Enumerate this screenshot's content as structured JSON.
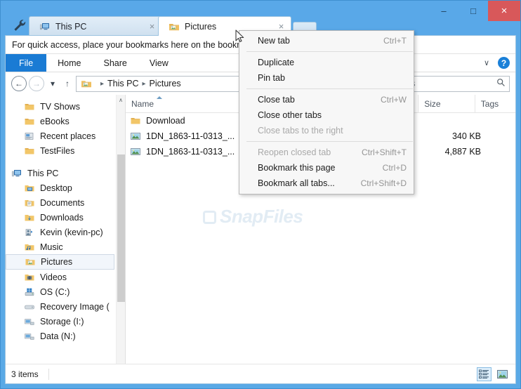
{
  "window": {
    "accent_color": "#59a8e8",
    "close_color": "#d8585a",
    "buttons": {
      "minimize": "–",
      "maximize": "□",
      "close": "×"
    }
  },
  "tabstrip": {
    "tabs": [
      {
        "label": "This PC",
        "icon": "computer-icon",
        "close": "×",
        "active": false
      },
      {
        "label": "Pictures",
        "icon": "pictures-folder-icon",
        "close": "×",
        "active": true
      }
    ],
    "new_tab_button": ""
  },
  "bookmark_bar": {
    "hint": "For quick access, place your bookmarks here on the bookma"
  },
  "ribbon": {
    "tabs": [
      {
        "label": "File",
        "selected": true
      },
      {
        "label": "Home",
        "selected": false
      },
      {
        "label": "Share",
        "selected": false
      },
      {
        "label": "View",
        "selected": false
      }
    ],
    "expand_chevron": "∨",
    "help": "?"
  },
  "address_bar": {
    "back": "←",
    "forward": "→",
    "recent": "▾",
    "up": "↑",
    "crumbs": [
      "This PC",
      "Pictures"
    ],
    "separator": "▸"
  },
  "search": {
    "value": "",
    "placeholder": "res",
    "icon": "search-icon"
  },
  "nav_pane": {
    "groups": [
      {
        "items": [
          {
            "label": "TV Shows",
            "icon": "folder-icon",
            "indent": true
          },
          {
            "label": "eBooks",
            "icon": "folder-icon",
            "indent": true
          },
          {
            "label": "Recent places",
            "icon": "recent-places-icon",
            "indent": true
          },
          {
            "label": "TestFiles",
            "icon": "folder-icon",
            "indent": true
          }
        ]
      },
      {
        "items": [
          {
            "label": "This PC",
            "icon": "computer-icon",
            "root": true
          },
          {
            "label": "Desktop",
            "icon": "desktop-folder-icon",
            "indent": true
          },
          {
            "label": "Documents",
            "icon": "documents-folder-icon",
            "indent": true
          },
          {
            "label": "Downloads",
            "icon": "downloads-folder-icon",
            "indent": true
          },
          {
            "label": "Kevin (kevin-pc)",
            "icon": "user-folder-icon",
            "indent": true
          },
          {
            "label": "Music",
            "icon": "music-folder-icon",
            "indent": true
          },
          {
            "label": "Pictures",
            "icon": "pictures-folder-icon",
            "indent": true,
            "selected": true
          },
          {
            "label": "Videos",
            "icon": "videos-folder-icon",
            "indent": true
          },
          {
            "label": "OS (C:)",
            "icon": "system-drive-icon",
            "indent": true
          },
          {
            "label": "Recovery Image (",
            "icon": "drive-icon",
            "indent": true
          },
          {
            "label": "Storage (I:)",
            "icon": "network-drive-icon",
            "indent": true
          },
          {
            "label": "Data (N:)",
            "icon": "network-drive-icon",
            "indent": true
          }
        ]
      }
    ],
    "scroll_up": "∧",
    "scroll_down": "∨"
  },
  "file_list": {
    "columns": [
      {
        "label": "Name",
        "sorted": "asc"
      },
      {
        "label": "Size"
      },
      {
        "label": "Tags"
      }
    ],
    "rows": [
      {
        "name": "Download",
        "icon": "folder-icon",
        "size": "",
        "tags": ""
      },
      {
        "name": "1DN_1863-11-0313_...",
        "icon": "image-file-icon",
        "size": "340 KB",
        "tags": ""
      },
      {
        "name": "1DN_1863-11-0313_...",
        "icon": "image-file-icon",
        "size": "4,887 KB",
        "tags": ""
      }
    ],
    "watermark": "SnapFiles"
  },
  "scrollbars": {
    "left_arrow": "‹",
    "right_arrow": "›"
  },
  "status_bar": {
    "item_count": "3 items",
    "views": [
      {
        "name": "details-view-icon",
        "active": true
      },
      {
        "name": "thumbnail-view-icon",
        "active": false
      }
    ]
  },
  "context_menu": {
    "items": [
      {
        "label": "New tab",
        "accel": "Ctrl+T",
        "disabled": false
      },
      {
        "divider": true
      },
      {
        "label": "Duplicate",
        "accel": "",
        "disabled": false
      },
      {
        "label": "Pin tab",
        "accel": "",
        "disabled": false
      },
      {
        "divider": true
      },
      {
        "label": "Close tab",
        "accel": "Ctrl+W",
        "disabled": false
      },
      {
        "label": "Close other tabs",
        "accel": "",
        "disabled": false
      },
      {
        "label": "Close tabs to the right",
        "accel": "",
        "disabled": true
      },
      {
        "divider": true
      },
      {
        "label": "Reopen closed tab",
        "accel": "Ctrl+Shift+T",
        "disabled": true
      },
      {
        "label": "Bookmark this page",
        "accel": "Ctrl+D",
        "disabled": false
      },
      {
        "label": "Bookmark all tabs...",
        "accel": "Ctrl+Shift+D",
        "disabled": false
      }
    ]
  }
}
